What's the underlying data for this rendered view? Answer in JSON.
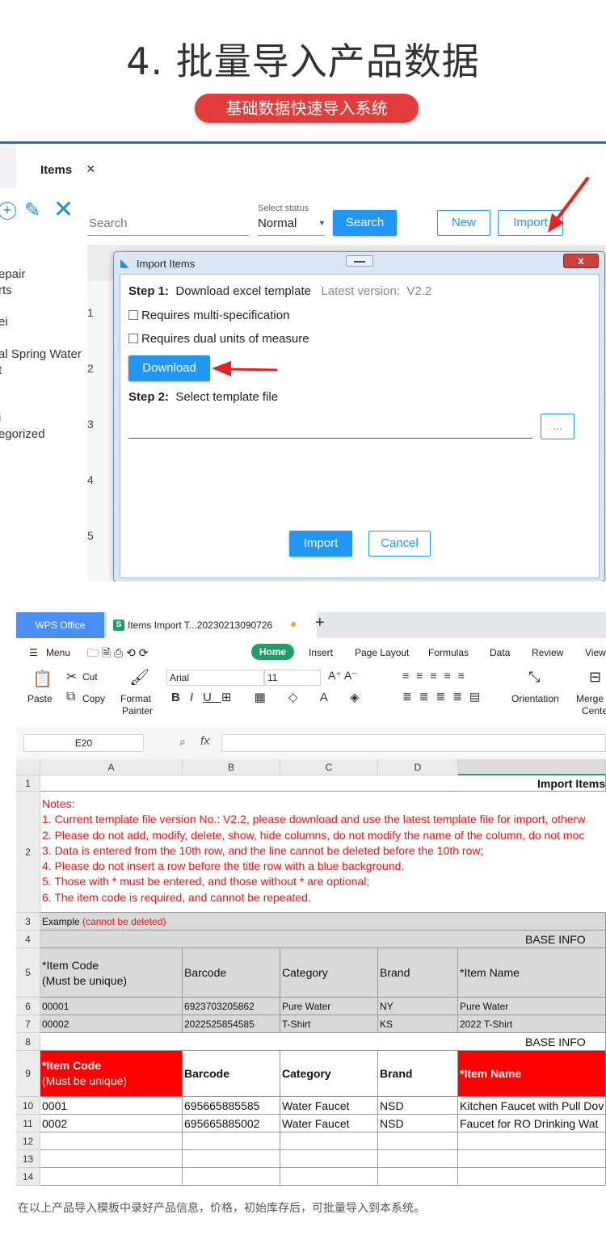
{
  "header": {
    "title": "4. 批量导入产品数据",
    "subtitle": "基础数据快速导入系统"
  },
  "app": {
    "tab_label": "Items",
    "tab_close": "×",
    "side_items": [
      "epair",
      "rts",
      "ei",
      "al Spring Water",
      "t",
      "i",
      "egorized"
    ],
    "search_placeholder": "Search",
    "status_label": "Select status",
    "status_value": "Normal",
    "btn_search": "Search",
    "btn_new": "New",
    "btn_import": "Import",
    "grid_row_numbers": [
      "1",
      "2",
      "3",
      "4",
      "5"
    ],
    "colors": {
      "accent": "#2196f3",
      "brand_border": "#2a6bbd"
    }
  },
  "dialog": {
    "title": "Import Items",
    "step1_label": "Step 1:",
    "step1_text": "Download excel template",
    "version_label": "Latest version:",
    "version_value": "V2.2",
    "chk_multi_spec": "Requires multi-specification",
    "chk_dual_units": "Requires dual units of measure",
    "btn_download": "Download",
    "step2_label": "Step 2:",
    "step2_text": "Select template file",
    "btn_browse": "...",
    "btn_import": "Import",
    "btn_cancel": "Cancel",
    "close_glyph": "x"
  },
  "wps": {
    "office_tab": "WPS Office",
    "doc_tab": "Items Import T...20230213090726",
    "menu": {
      "menu": "Menu",
      "home": "Home",
      "insert": "Insert",
      "page_layout": "Page Layout",
      "formulas": "Formulas",
      "data": "Data",
      "review": "Review",
      "view": "View"
    },
    "ribbon": {
      "paste": "Paste",
      "cut": "Cut",
      "copy": "Copy",
      "format_painter_1": "Format",
      "format_painter_2": "Painter",
      "font": "Arial",
      "size": "11",
      "orientation": "Orientation",
      "merge_1": "Merge",
      "merge_2": "Cente"
    },
    "name_box": "E20",
    "fx": "fx"
  },
  "sheet": {
    "columns": [
      "A",
      "B",
      "C",
      "D",
      ""
    ],
    "rows": [
      "1",
      "2",
      "3",
      "4",
      "5",
      "6",
      "7",
      "8",
      "9",
      "10",
      "11",
      "12",
      "13",
      "14"
    ],
    "title": "Import Items",
    "notes": [
      "Notes:",
      "1. Current template file version No.: V2.2, please download and use the latest template file for import, otherw",
      "2. Please do not add, modify, delete, show, hide columns, do not modify the name of the column, do not moc",
      "3. Data is entered from the 10th row, and the line cannot be deleted before the 10th row;",
      "4. Please do not insert a row before the title row with a blue background.",
      "5. Those with * must be entered, and those without * are optional;",
      "6. The item code is required, and cannot be repeated."
    ],
    "example_label": "Example",
    "example_note": "(cannot be deleted)",
    "base_info": "BASE INFO",
    "headers": {
      "item_code_1": "*Item Code",
      "item_code_2": "(Must be unique)",
      "barcode": "Barcode",
      "category": "Category",
      "brand": "Brand",
      "item_name": "*Item Name"
    },
    "example_rows": [
      [
        "00001",
        "6923703205862",
        "Pure Water",
        "NY",
        "Pure Water"
      ],
      [
        "00002",
        "2022525854585",
        "T-Shirt",
        "KS",
        "2022 T-Shirt"
      ]
    ],
    "data_rows": [
      [
        "0001",
        "695665885585",
        "Water Faucet",
        "NSD",
        "Kitchen Faucet with Pull Dov"
      ],
      [
        "0002",
        "695665885002",
        "Water Faucet",
        "NSD",
        "Faucet for RO Drinking Wat"
      ]
    ]
  },
  "caption": "在以上产品导入模板中录好产品信息，价格，初始库存后，可批量导入到本系统。"
}
